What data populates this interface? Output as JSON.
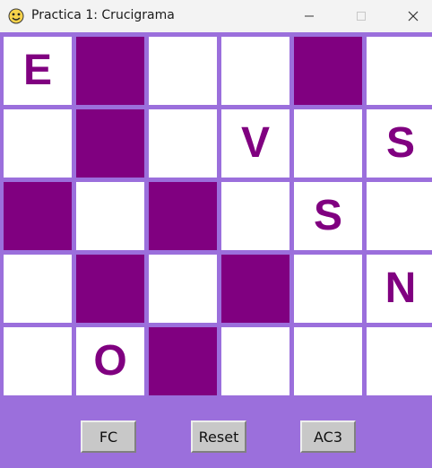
{
  "window": {
    "title": "Practica 1: Crucigrama",
    "icon": "python-logo-icon"
  },
  "board": {
    "rows": 5,
    "cols": 6,
    "cells": [
      [
        {
          "type": "white",
          "letter": "E"
        },
        {
          "type": "black",
          "letter": ""
        },
        {
          "type": "white",
          "letter": ""
        },
        {
          "type": "white",
          "letter": ""
        },
        {
          "type": "black",
          "letter": ""
        },
        {
          "type": "white",
          "letter": ""
        }
      ],
      [
        {
          "type": "white",
          "letter": ""
        },
        {
          "type": "black",
          "letter": ""
        },
        {
          "type": "white",
          "letter": ""
        },
        {
          "type": "white",
          "letter": "V"
        },
        {
          "type": "white",
          "letter": ""
        },
        {
          "type": "white",
          "letter": "S"
        }
      ],
      [
        {
          "type": "black",
          "letter": ""
        },
        {
          "type": "white",
          "letter": ""
        },
        {
          "type": "black",
          "letter": ""
        },
        {
          "type": "white",
          "letter": ""
        },
        {
          "type": "white",
          "letter": "S"
        },
        {
          "type": "white",
          "letter": ""
        }
      ],
      [
        {
          "type": "white",
          "letter": ""
        },
        {
          "type": "black",
          "letter": ""
        },
        {
          "type": "white",
          "letter": ""
        },
        {
          "type": "black",
          "letter": ""
        },
        {
          "type": "white",
          "letter": ""
        },
        {
          "type": "white",
          "letter": "N"
        }
      ],
      [
        {
          "type": "white",
          "letter": ""
        },
        {
          "type": "white",
          "letter": "O"
        },
        {
          "type": "black",
          "letter": ""
        },
        {
          "type": "white",
          "letter": ""
        },
        {
          "type": "white",
          "letter": ""
        },
        {
          "type": "white",
          "letter": ""
        }
      ]
    ]
  },
  "buttons": {
    "fc": "FC",
    "reset": "Reset",
    "ac3": "AC3"
  },
  "colors": {
    "background": "#9b6fdc",
    "blocked_cell": "#800080",
    "open_cell": "#ffffff",
    "letter": "#800080"
  }
}
